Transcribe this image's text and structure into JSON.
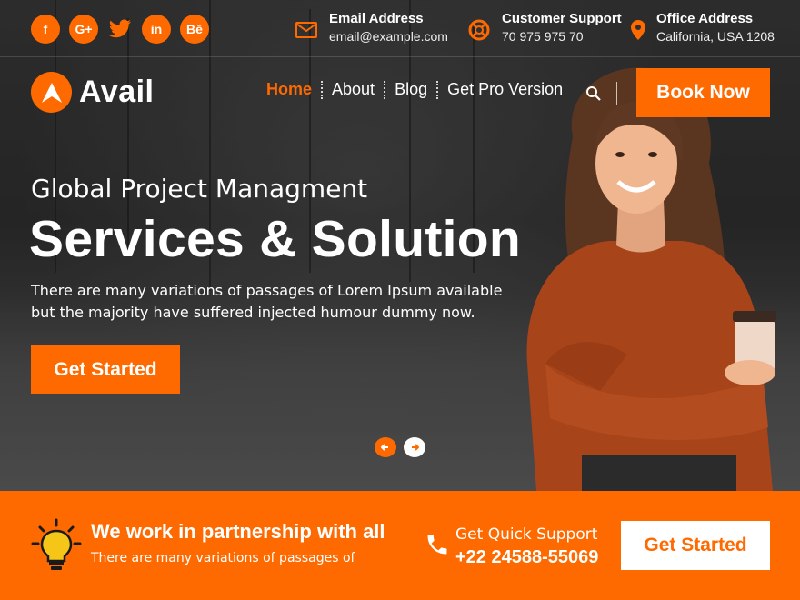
{
  "social": [
    {
      "icon": "facebook-icon",
      "glyph": "f"
    },
    {
      "icon": "google-plus-icon",
      "glyph": "G+"
    },
    {
      "icon": "twitter-icon",
      "glyph": ""
    },
    {
      "icon": "linkedin-icon",
      "glyph": "in"
    },
    {
      "icon": "behance-icon",
      "glyph": "Bē"
    }
  ],
  "contact": {
    "email": {
      "title": "Email Address",
      "value": "email@example.com"
    },
    "support": {
      "title": "Customer Support",
      "value": "70 975 975 70"
    },
    "office": {
      "title": "Office Address",
      "value": "California, USA 1208"
    }
  },
  "logo": {
    "name": "Avail"
  },
  "nav": {
    "items": [
      "Home",
      "About",
      "Blog",
      "Get Pro Version"
    ],
    "book_label": "Book Now"
  },
  "hero": {
    "subtitle": "Global Project Managment",
    "headline": "Services & Solution",
    "description": "There are many variations of passages of Lorem Ipsum available but the majority have suffered injected humour dummy now.",
    "cta_label": "Get Started"
  },
  "band": {
    "title": "We work in partnership with all",
    "subtitle": "There are many variations of passages of",
    "support_label": "Get Quick Support",
    "support_phone": "+22 24588-55069",
    "cta_label": "Get Started"
  },
  "colors": {
    "accent": "#ff6a00",
    "dark": "#2a2a2a"
  }
}
